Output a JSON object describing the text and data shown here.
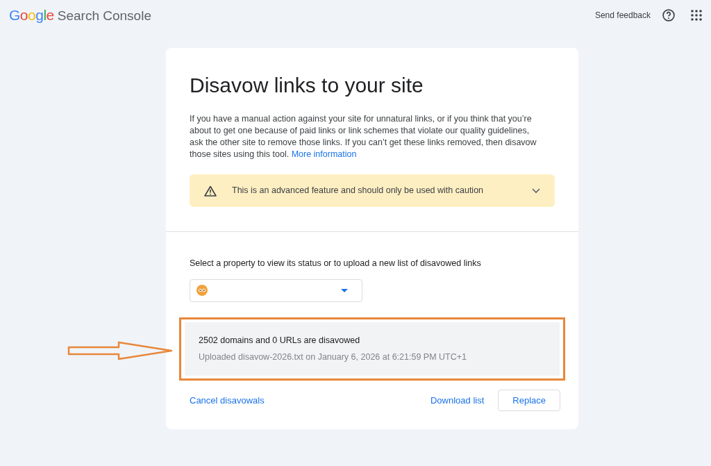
{
  "header": {
    "logo_brand": "Google",
    "logo_product": "Search Console",
    "feedback": "Send feedback"
  },
  "card": {
    "title": "Disavow links to your site",
    "intro": "If you have a manual action against your site for unnatural links, or if you think that you’re about to get one because of paid links or link schemes that violate our quality guidelines, ask the other site to remove those links. If you can’t get these links removed, then disavow those sites using this tool.",
    "intro_link": "More information",
    "warning": {
      "text": "This is an advanced feature and should only be used with caution",
      "expanded": false
    },
    "property_label": "Select a property to view its status or to upload a new list of disavowed links",
    "status": {
      "headline": "2502 domains and 0 URLs are disavowed",
      "detail": "Uploaded disavow-2026.txt on January 6, 2026 at 6:21:59 PM UTC+1",
      "highlighted": true
    },
    "actions": [
      {
        "label": "Cancel disavowals",
        "kind": "link"
      },
      {
        "label": "Download list",
        "kind": "link"
      },
      {
        "label": "Replace",
        "kind": "outlined"
      }
    ]
  }
}
